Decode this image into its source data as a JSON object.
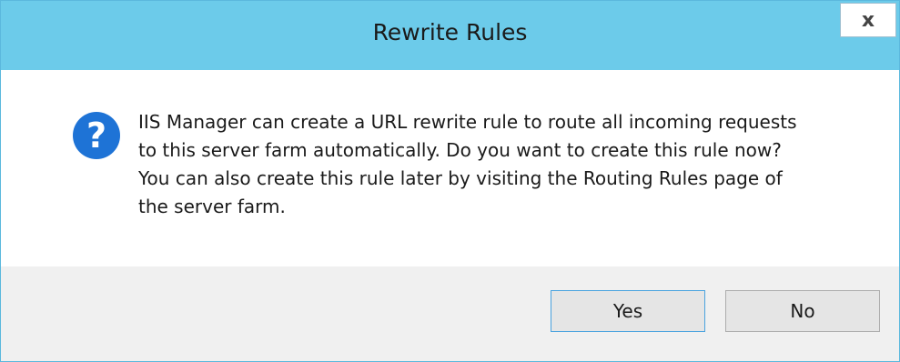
{
  "window": {
    "title": "Rewrite Rules",
    "close_label": "x"
  },
  "message": {
    "icon": "question-icon",
    "icon_glyph": "?",
    "lines": [
      "IIS Manager can create a URL rewrite rule to route all incoming requests",
      "to this server farm automatically. Do you want to create this rule now?",
      "You can also create this rule later by visiting the Routing Rules page of",
      "the server farm."
    ]
  },
  "buttons": {
    "yes_label": "Yes",
    "no_label": "No"
  },
  "colors": {
    "titlebar": "#6ccbea",
    "icon": "#1e73d6",
    "footer": "#f0f0f0"
  }
}
